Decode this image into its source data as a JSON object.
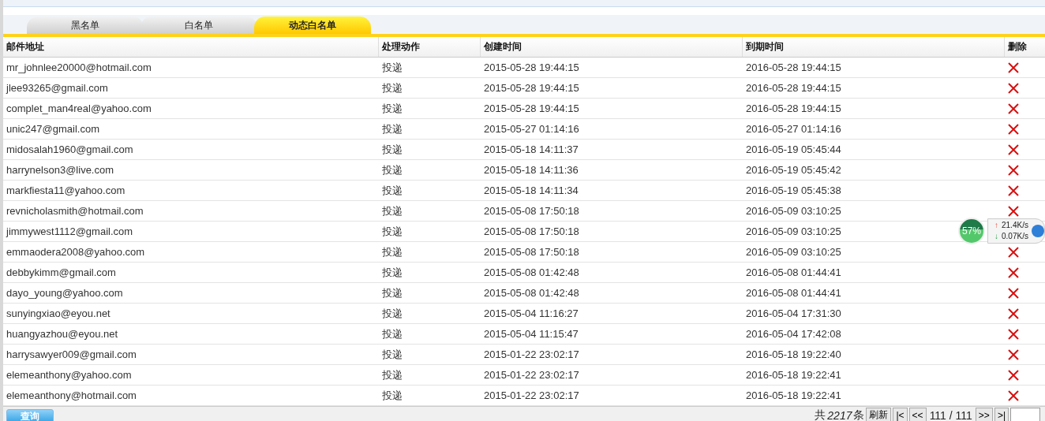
{
  "tabs": [
    {
      "label": "黑名单",
      "selected": false
    },
    {
      "label": "白名单",
      "selected": false
    },
    {
      "label": "动态白名单",
      "selected": true
    }
  ],
  "table": {
    "columns": [
      "邮件地址",
      "处理动作",
      "创建时间",
      "到期时间",
      "删除"
    ],
    "rows": [
      [
        "mr_johnlee20000@hotmail.com",
        "投递",
        "2015-05-28 19:44:15",
        "2016-05-28 19:44:15"
      ],
      [
        "jlee93265@gmail.com",
        "投递",
        "2015-05-28 19:44:15",
        "2016-05-28 19:44:15"
      ],
      [
        "complet_man4real@yahoo.com",
        "投递",
        "2015-05-28 19:44:15",
        "2016-05-28 19:44:15"
      ],
      [
        "unic247@gmail.com",
        "投递",
        "2015-05-27 01:14:16",
        "2016-05-27 01:14:16"
      ],
      [
        "midosalah1960@gmail.com",
        "投递",
        "2015-05-18 14:11:37",
        "2016-05-19 05:45:44"
      ],
      [
        "harrynelson3@live.com",
        "投递",
        "2015-05-18 14:11:36",
        "2016-05-19 05:45:42"
      ],
      [
        "markfiesta11@yahoo.com",
        "投递",
        "2015-05-18 14:11:34",
        "2016-05-19 05:45:38"
      ],
      [
        "revnicholasmith@hotmail.com",
        "投递",
        "2015-05-08 17:50:18",
        "2016-05-09 03:10:25"
      ],
      [
        "jimmywest1112@gmail.com",
        "投递",
        "2015-05-08 17:50:18",
        "2016-05-09 03:10:25"
      ],
      [
        "emmaodera2008@yahoo.com",
        "投递",
        "2015-05-08 17:50:18",
        "2016-05-09 03:10:25"
      ],
      [
        "debbykimm@gmail.com",
        "投递",
        "2015-05-08 01:42:48",
        "2016-05-08 01:44:41"
      ],
      [
        "dayo_young@yahoo.com",
        "投递",
        "2015-05-08 01:42:48",
        "2016-05-08 01:44:41"
      ],
      [
        "sunyingxiao@eyou.net",
        "投递",
        "2015-05-04 11:16:27",
        "2016-05-04 17:31:30"
      ],
      [
        "huangyazhou@eyou.net",
        "投递",
        "2015-05-04 11:15:47",
        "2016-05-04 17:42:08"
      ],
      [
        "harrysawyer009@gmail.com",
        "投递",
        "2015-01-22 23:02:17",
        "2016-05-18 19:22:40"
      ],
      [
        "elemeanthony@yahoo.com",
        "投递",
        "2015-01-22 23:02:17",
        "2016-05-18 19:22:41"
      ],
      [
        "elemeanthony@hotmail.com",
        "投递",
        "2015-01-22 23:02:17",
        "2016-05-18 19:22:41"
      ]
    ]
  },
  "footer": {
    "query_button": "查询",
    "total_prefix": "共",
    "total": "2217",
    "total_suffix": "条",
    "refresh_button": "刷新",
    "first_button": "|<",
    "prev_button": "<<",
    "page": "111 / 111",
    "next_button": ">>",
    "last_button": ">|"
  },
  "speed_widget": {
    "percent": "57%",
    "upload_arrow": "↑",
    "upload": "21.4K/s",
    "download_arrow": "↓",
    "download": "0.07K/s"
  }
}
